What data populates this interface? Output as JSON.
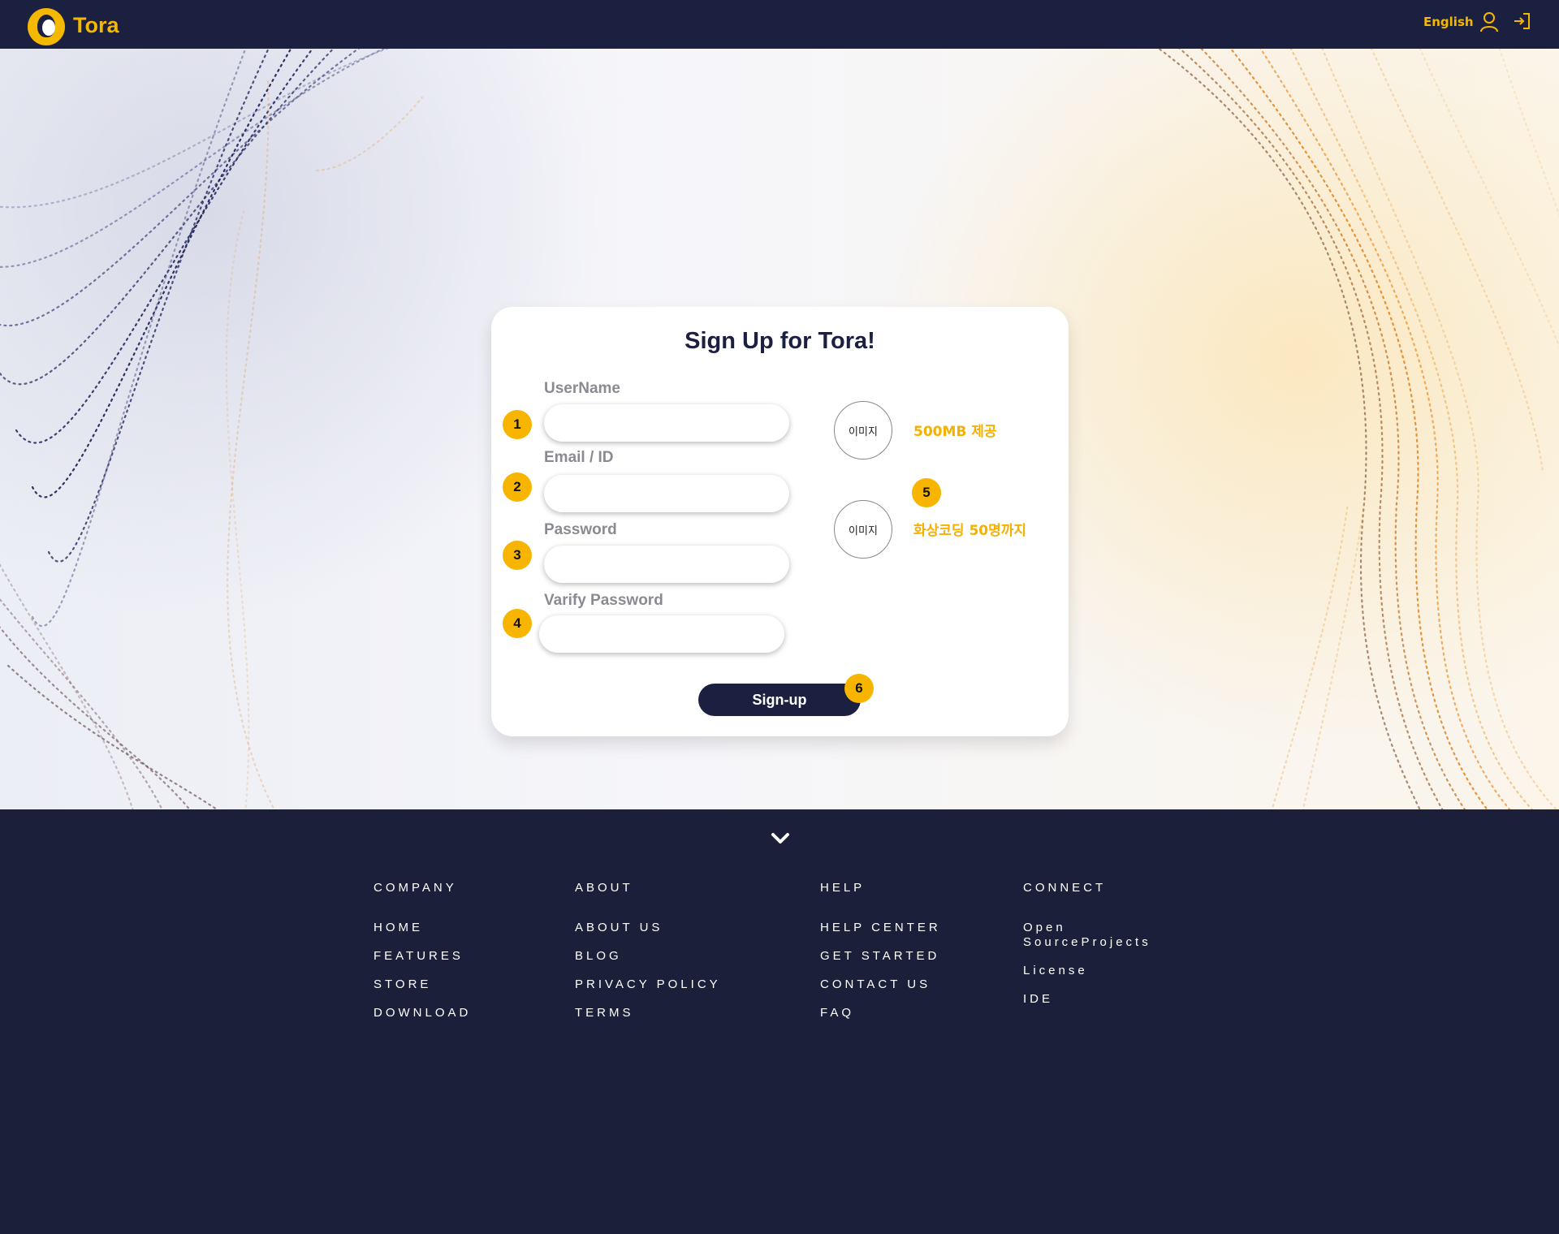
{
  "header": {
    "logo_text": "Tora",
    "language": "English",
    "user_icon": "user-icon",
    "login_icon": "login-icon"
  },
  "card": {
    "title": "Sign Up for Tora!",
    "fields": [
      {
        "badge": "1",
        "label": "UserName",
        "value": "",
        "placeholder": ""
      },
      {
        "badge": "2",
        "label": "Email / ID",
        "value": "",
        "placeholder": ""
      },
      {
        "badge": "3",
        "label": "Password",
        "value": "",
        "placeholder": ""
      },
      {
        "badge": "4",
        "label": "Varify Password",
        "value": "",
        "placeholder": ""
      }
    ],
    "features": [
      {
        "image_label": "이미지",
        "text": "500MB 제공"
      },
      {
        "image_label": "이미지",
        "text": "화상코딩 50명까지",
        "badge": "5"
      }
    ],
    "signup_label": "Sign-up",
    "signup_badge": "6"
  },
  "footer": {
    "chevron_icon": "chevron-down-icon",
    "columns": [
      {
        "heading": "COMPANY",
        "links": [
          "HOME",
          "FEATURES",
          "STORE",
          "DOWNLOAD"
        ]
      },
      {
        "heading": "ABOUT",
        "links": [
          "ABOUT US",
          "BLOG",
          "PRIVACY POLICY",
          "TERMS"
        ]
      },
      {
        "heading": "HELP",
        "links": [
          "HELP CENTER",
          "GET STARTED",
          "CONTACT US",
          "FAQ"
        ]
      },
      {
        "heading": "CONNECT",
        "links": [
          "Open SourceProjects",
          "License",
          "IDE"
        ]
      }
    ]
  },
  "colors": {
    "navy": "#1c2040",
    "accent": "#f5b800"
  }
}
